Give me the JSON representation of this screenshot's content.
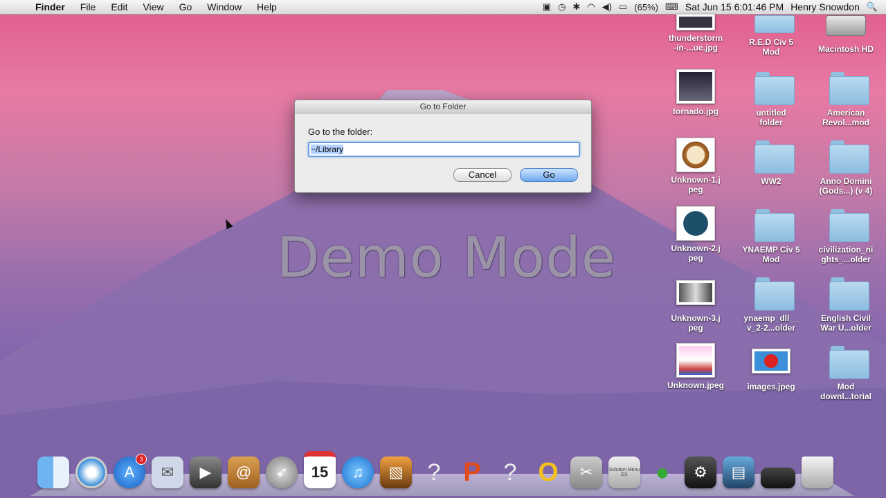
{
  "menubar": {
    "app_name": "Finder",
    "menus": [
      "File",
      "Edit",
      "View",
      "Go",
      "Window",
      "Help"
    ],
    "battery": "(65%)",
    "datetime": "Sat Jun 15  6:01:46 PM",
    "user": "Henry Snowdon"
  },
  "dialog": {
    "title": "Go to Folder",
    "prompt": "Go to the folder:",
    "path_value": "~/Library",
    "cancel_label": "Cancel",
    "go_label": "Go"
  },
  "watermark": "Demo Mode",
  "desktop_icons": [
    [
      "thunderstorm",
      "-in-...ue.jpg"
    ],
    [
      "R.E.D Civ 5",
      "Mod"
    ],
    [
      "Macintosh HD",
      ""
    ],
    [
      "tornado.jpg",
      ""
    ],
    [
      "untitled",
      "folder"
    ],
    [
      "American",
      "Revol...mod"
    ],
    [
      "Unknown-1.j",
      "peg"
    ],
    [
      "WW2",
      ""
    ],
    [
      "Anno Domini",
      "(Gods...) (v 4)"
    ],
    [
      "Unknown-2.j",
      "peg"
    ],
    [
      "YNAEMP Civ 5",
      "Mod"
    ],
    [
      "civilization_ni",
      "ghts_...older"
    ],
    [
      "Unknown-3.j",
      "peg"
    ],
    [
      "ynaemp_dll__",
      "v_2-2...older"
    ],
    [
      "English Civil",
      "War U...older"
    ],
    [
      "Unknown.jpeg",
      ""
    ],
    [
      "images.jpeg",
      ""
    ],
    [
      "Mod",
      "downl...torial"
    ]
  ],
  "dock": {
    "items": [
      "finder-icon",
      "safari-icon",
      "app-store-icon",
      "mail-stamp-icon",
      "facetime-icon",
      "address-book-icon",
      "launchpad-icon",
      "calendar-icon",
      "itunes-icon",
      "iphoto-icon",
      "unknown-app-icon",
      "powerpoint-icon",
      "unknown-app-icon",
      "opera-icon",
      "system-tools-icon",
      "solution-menu-icon",
      "adium-icon",
      "steam-icon",
      "photo-booth-icon",
      "display-icon",
      "trash-icon"
    ],
    "calendar_day": "15",
    "app_store_badge": "3",
    "solution_label": "Solution Menu EX"
  }
}
